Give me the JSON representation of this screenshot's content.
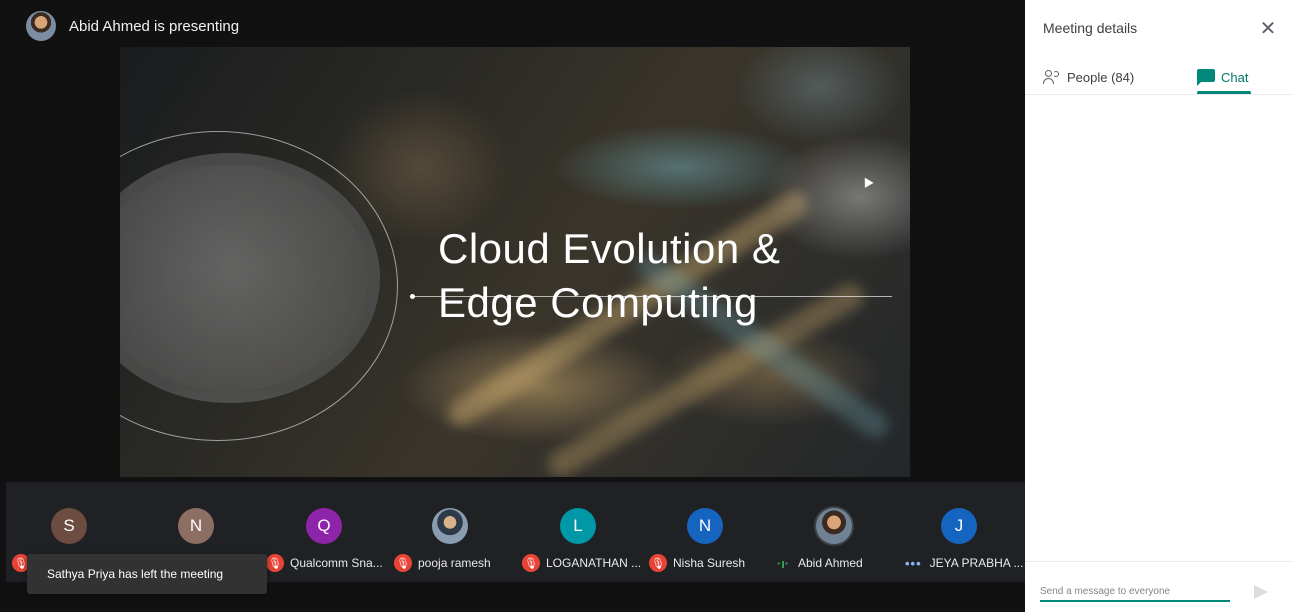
{
  "presenter": {
    "text": "Abid Ahmed is presenting"
  },
  "slide": {
    "title_line1": "Cloud Evolution &",
    "title_line2": "Edge Computing"
  },
  "participants": [
    {
      "initial": "S",
      "name": "",
      "avatar_color": "#6d4c41",
      "status": "muted"
    },
    {
      "initial": "N",
      "name": "",
      "avatar_color": "#8d6e63",
      "status": "muted"
    },
    {
      "initial": "Q",
      "name": "Qualcomm Sna...",
      "avatar_color": "#8e24aa",
      "status": "muted"
    },
    {
      "initial": "",
      "name": "pooja ramesh",
      "avatar_color": "#5c6b7a",
      "status": "muted"
    },
    {
      "initial": "L",
      "name": "LOGANATHAN ...",
      "avatar_color": "#0097a7",
      "status": "muted"
    },
    {
      "initial": "N",
      "name": "Nisha Suresh",
      "avatar_color": "#1565c0",
      "status": "muted"
    },
    {
      "initial": "",
      "name": "Abid Ahmed",
      "avatar_color": "#4a5b6e",
      "status": "speaking"
    },
    {
      "initial": "J",
      "name": "JEYA PRABHA ...",
      "avatar_color": "#1565c0",
      "status": "more"
    }
  ],
  "toast": {
    "text": "Sathya Priya has left the meeting"
  },
  "panel": {
    "title": "Meeting details",
    "tabs": {
      "people_label": "People (84)",
      "chat_label": "Chat",
      "active": "chat"
    },
    "composer": {
      "placeholder": "Send a message to everyone"
    }
  },
  "colors": {
    "accent": "#00897b",
    "mic_off": "#ea4335",
    "strip_bg": "#202124"
  },
  "icons": {
    "close": "close-icon",
    "people": "people-icon",
    "chat": "chat-icon",
    "send": "send-icon",
    "mic_off": "mic-off-icon"
  }
}
